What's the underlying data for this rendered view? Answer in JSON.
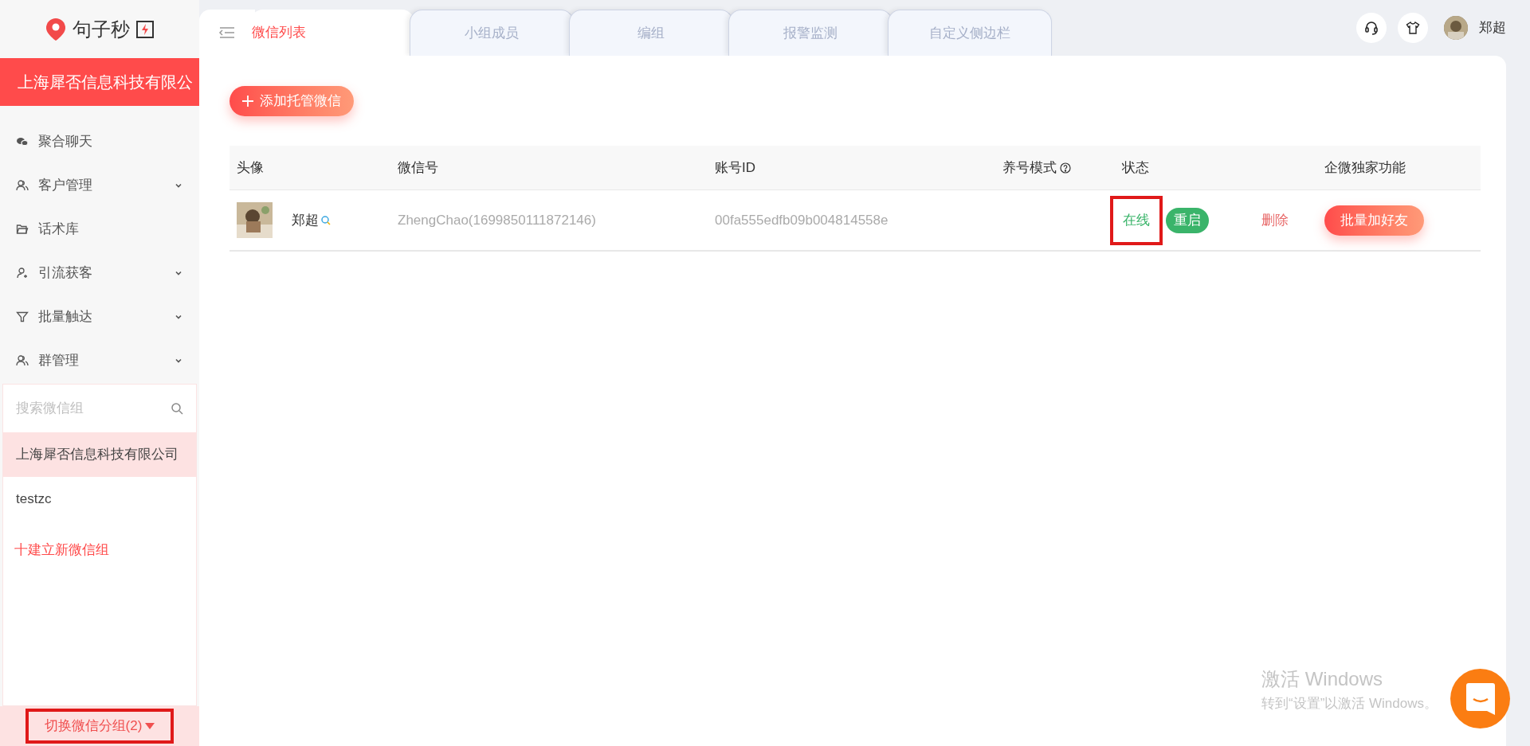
{
  "logo": {
    "text": "句子秒"
  },
  "company": "上海犀否信息科技有限公",
  "menu": [
    {
      "label": "聚合聊天",
      "kind": "chat",
      "expandable": false
    },
    {
      "label": "客户管理",
      "kind": "users",
      "expandable": true
    },
    {
      "label": "话术库",
      "kind": "folder",
      "expandable": false
    },
    {
      "label": "引流获客",
      "kind": "useradd",
      "expandable": true
    },
    {
      "label": "批量触达",
      "kind": "filter",
      "expandable": true
    },
    {
      "label": "群管理",
      "kind": "users",
      "expandable": true
    }
  ],
  "group_search": {
    "placeholder": "搜索微信组"
  },
  "groups": [
    {
      "label": "上海犀否信息科技有限公司",
      "selected": true
    },
    {
      "label": "testzc",
      "selected": false
    }
  ],
  "new_group": "十建立新微信组",
  "switch_group": "切换微信分组(2)",
  "tabs": [
    {
      "label": "微信列表",
      "selected": true
    },
    {
      "label": "小组成员",
      "selected": false
    },
    {
      "label": "编组",
      "selected": false
    },
    {
      "label": "报警监测",
      "selected": false
    },
    {
      "label": "自定义侧边栏",
      "selected": false
    }
  ],
  "user": {
    "name": "郑超"
  },
  "add_button": "添加托管微信",
  "table": {
    "columns": [
      "头像",
      "微信号",
      "账号ID",
      "养号模式",
      "状态",
      "企微独家功能"
    ],
    "rows": [
      {
        "name": "郑超",
        "wechat_id": "ZhengChao(1699850111872146)",
        "account_id": "00fa555edfb09b004814558e",
        "status": "在线",
        "restart": "重启",
        "delete": "删除",
        "batch": "批量加好友"
      }
    ]
  },
  "windows_notice": {
    "title": "激活 Windows",
    "subtitle": "转到“设置”以激活 Windows。"
  }
}
